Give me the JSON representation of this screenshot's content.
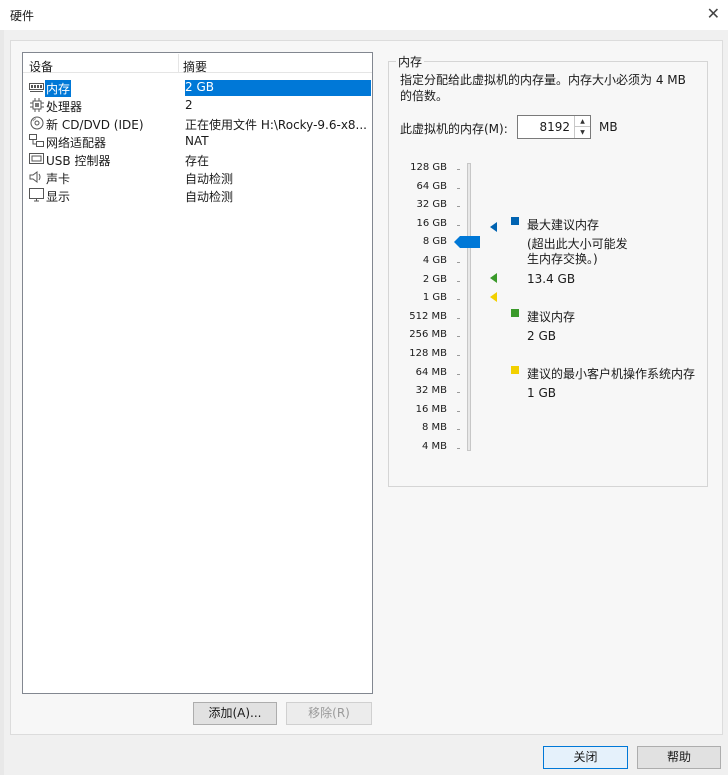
{
  "window": {
    "title": "硬件"
  },
  "device_list": {
    "headers": {
      "device": "设备",
      "summary": "摘要"
    },
    "rows": [
      {
        "name": "内存",
        "summary": "2 GB",
        "icon": "memory-icon"
      },
      {
        "name": "处理器",
        "summary": "2",
        "icon": "processor-icon"
      },
      {
        "name": "新 CD/DVD (IDE)",
        "summary": "正在使用文件 H:\\Rocky-9.6-x8...",
        "icon": "cd-dvd-icon"
      },
      {
        "name": "网络适配器",
        "summary": "NAT",
        "icon": "network-adapter-icon"
      },
      {
        "name": "USB 控制器",
        "summary": "存在",
        "icon": "usb-controller-icon"
      },
      {
        "name": "声卡",
        "summary": "自动检测",
        "icon": "sound-card-icon"
      },
      {
        "name": "显示",
        "summary": "自动检测",
        "icon": "display-icon"
      }
    ],
    "selected_index": 0
  },
  "buttons": {
    "add": "添加(A)...",
    "remove": "移除(R)",
    "close": "关闭",
    "help": "帮助"
  },
  "memory": {
    "group_title": "内存",
    "description": "指定分配给此虚拟机的内存量。内存大小必须为 4 MB 的倍数。",
    "label": "此虚拟机的内存(M):",
    "value": "8192",
    "unit": "MB",
    "scale_labels": [
      "128 GB",
      "64 GB",
      "32 GB",
      "16 GB",
      "8 GB",
      "4 GB",
      "2 GB",
      "1 GB",
      "512 MB",
      "256 MB",
      "128 MB",
      "64 MB",
      "32 MB",
      "16 MB",
      "8 MB",
      "4 MB"
    ],
    "legend": {
      "max_title": "最大建议内存",
      "max_note": "(超出此大小可能发生内存交换。)",
      "max_value": "13.4 GB",
      "recommended_title": "建议内存",
      "recommended_value": "2 GB",
      "min_title": "建议的最小客户机操作系统内存",
      "min_value": "1 GB"
    },
    "colors": {
      "max": "#0063b1",
      "recommended": "#3a9a2a",
      "min": "#f2d000",
      "thumb": "#0078d7"
    }
  }
}
